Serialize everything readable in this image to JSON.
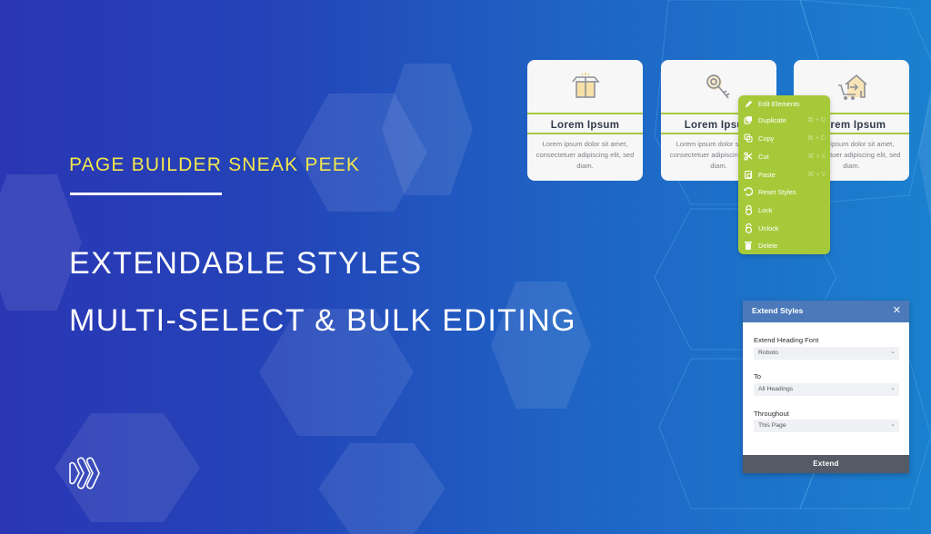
{
  "banner": {
    "kicker": "PAGE BUILDER SNEAK PEEK",
    "headline_1": "EXTENDABLE STYLES",
    "headline_2": "MULTI-SELECT & BULK EDITING",
    "logo_icon": "chevrons-logo-icon"
  },
  "colors": {
    "kicker": "#f2e64d",
    "accent_green": "#a6c93a",
    "dialog_header": "#4b79ba",
    "dialog_footer": "#555a66"
  },
  "cards": [
    {
      "icon": "open-box-icon",
      "title": "Lorem Ipsum",
      "desc": "Lorem ipsum dolor sit amet, consectetuer adipiscing elit, sed diam."
    },
    {
      "icon": "key-icon",
      "title": "Lorem Ipsum",
      "desc": "Lorem ipsum dolor sit amet, consectetuer adipiscing elit, sed diam."
    },
    {
      "icon": "home-cart-icon",
      "title": "Lorem Ipsum",
      "desc": "Lorem ipsum dolor sit amet, consectetuer adipiscing elit, sed diam."
    }
  ],
  "context_menu": {
    "items": [
      {
        "label": "Edit Elements",
        "icon": "pencil-icon",
        "shortcut": ""
      },
      {
        "label": "Duplicate",
        "icon": "duplicate-icon",
        "shortcut": "⌘ + D"
      },
      {
        "label": "Copy",
        "icon": "copy-icon",
        "shortcut": "⌘ + C"
      },
      {
        "label": "Cut",
        "icon": "scissors-icon",
        "shortcut": "⌘ + X"
      },
      {
        "label": "Paste",
        "icon": "paste-icon",
        "shortcut": "⌘ + V"
      },
      {
        "label": "Reset Styles",
        "icon": "reset-icon",
        "shortcut": ""
      },
      {
        "label": "Lock",
        "icon": "lock-icon",
        "shortcut": ""
      },
      {
        "label": "Unlock",
        "icon": "unlock-icon",
        "shortcut": ""
      },
      {
        "label": "Delete",
        "icon": "trash-icon",
        "shortcut": ""
      }
    ]
  },
  "dialog": {
    "title": "Extend Styles",
    "close": "✕",
    "fields": [
      {
        "label": "Extend Heading Font",
        "value": "Roboto"
      },
      {
        "label": "To",
        "value": "All Headings"
      },
      {
        "label": "Throughout",
        "value": "This Page"
      }
    ],
    "submit_label": "Extend"
  }
}
